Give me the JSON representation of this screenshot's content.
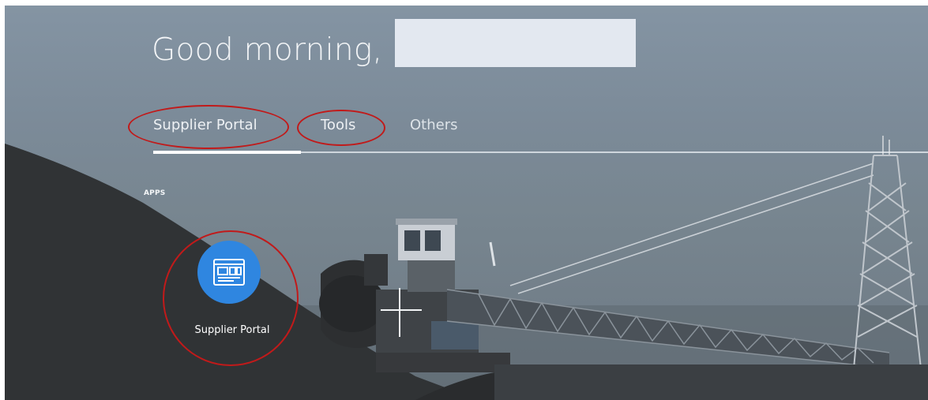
{
  "header": {
    "greeting": "Good morning,"
  },
  "tabs": [
    {
      "label": "Supplier Portal",
      "selected": true
    },
    {
      "label": "Tools",
      "selected": false
    },
    {
      "label": "Others",
      "selected": false
    }
  ],
  "apps_section": {
    "label": "APPS",
    "apps": [
      {
        "label": "Supplier Portal",
        "icon": "supplier-portal-icon"
      }
    ]
  },
  "colors": {
    "app_icon": "#2f86e0",
    "annotation": "#c11a1a"
  }
}
